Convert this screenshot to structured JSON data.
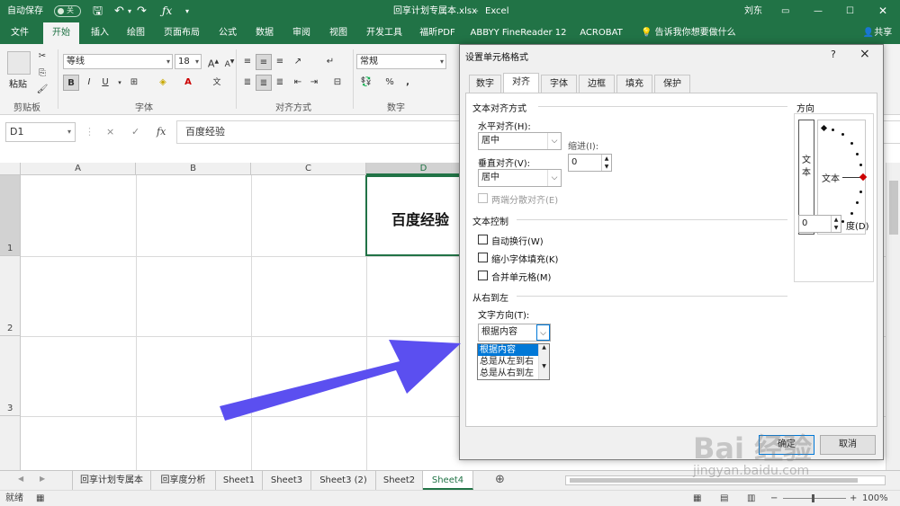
{
  "titlebar": {
    "autosave": "自动保存",
    "autosave_state": "关",
    "filename": "回享计划专属本.xlsx",
    "separator": "-",
    "app": "Excel",
    "user": "刘东"
  },
  "ribbon_tabs": [
    "文件",
    "开始",
    "插入",
    "绘图",
    "页面布局",
    "公式",
    "数据",
    "审阅",
    "视图",
    "开发工具",
    "福昕PDF",
    "ABBYY FineReader 12",
    "ACROBAT"
  ],
  "tell_me": "告诉我你想要做什么",
  "share": "共享",
  "ribbon": {
    "paste": "粘贴",
    "clipboard": "剪贴板",
    "font_name": "等线",
    "font_size": "18",
    "font_group": "字体",
    "align_group": "对齐方式",
    "number_format": "常规",
    "number_group": "数字",
    "bold": "B",
    "italic": "I",
    "underline": "U",
    "grow": "A",
    "shrink": "A",
    "percent": "%",
    "comma": ",",
    "font_color_glyph": "A",
    "wen": "文"
  },
  "formula": {
    "name_box": "D1",
    "cancel": "×",
    "enter": "✓",
    "fx": "fx",
    "content": "百度经验"
  },
  "columns": [
    "A",
    "B",
    "C",
    "D"
  ],
  "rows": [
    "1",
    "2",
    "3"
  ],
  "cell_d1": "百度经验",
  "sheets": [
    "回享计划专属本",
    "回享度分析",
    "Sheet1",
    "Sheet3",
    "Sheet3 (2)",
    "Sheet2",
    "Sheet4"
  ],
  "status": {
    "ready": "就绪",
    "zoom": "100%"
  },
  "dialog": {
    "title": "设置单元格格式",
    "help": "?",
    "close": "×",
    "tabs": [
      "数字",
      "对齐",
      "字体",
      "边框",
      "填充",
      "保护"
    ],
    "active_tab": "对齐",
    "text_align_section": "文本对齐方式",
    "h_align_label": "水平对齐(H):",
    "h_align_value": "居中",
    "indent_label": "缩进(I):",
    "indent_value": "0",
    "v_align_label": "垂直对齐(V):",
    "v_align_value": "居中",
    "justify_distributed": "两端分散对齐(E)",
    "text_control_section": "文本控制",
    "wrap_text": "自动换行(W)",
    "shrink_to_fit": "缩小字体填充(K)",
    "merge_cells": "合并单元格(M)",
    "rtl_section": "从右到左",
    "text_direction_label": "文字方向(T):",
    "text_direction_value": "根据内容",
    "text_direction_options": [
      "根据内容",
      "总是从左到右",
      "总是从右到左"
    ],
    "orientation_section": "方向",
    "orientation_vertical_text": "文本",
    "orientation_horizontal_text": "文本",
    "degrees_value": "0",
    "degrees_label": "度(D)",
    "ok": "确定",
    "cancel": "取消"
  },
  "watermark": {
    "text": "Bai 经验",
    "url": "jingyan.baidu.com"
  },
  "colors": {
    "excel_green": "#217346",
    "arrow": "#5b4ff0",
    "selection_blue": "#0078d7"
  }
}
